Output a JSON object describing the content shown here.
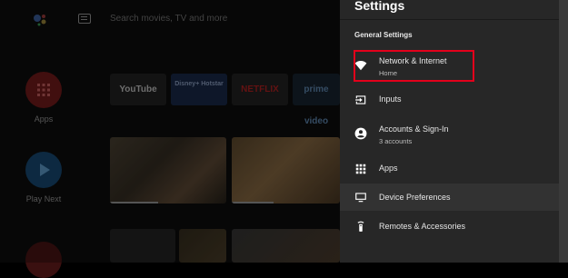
{
  "home": {
    "search": {
      "placeholder": "Search movies, TV and more"
    },
    "rail": [
      {
        "label": "Apps"
      },
      {
        "label": "Play Next"
      }
    ],
    "apps_row": [
      "YouTube",
      "Disney+ Hotstar",
      "NETFLIX",
      "prime video"
    ]
  },
  "settings_panel": {
    "title": "Settings",
    "section_header": "General Settings",
    "items": [
      {
        "label": "Network & Internet",
        "sub": "Home",
        "icon": "wifi-icon"
      },
      {
        "label": "Inputs",
        "sub": "",
        "icon": "input-icon"
      },
      {
        "label": "Accounts & Sign-In",
        "sub": "3 accounts",
        "icon": "account-icon"
      },
      {
        "label": "Apps",
        "sub": "",
        "icon": "apps-grid-icon"
      },
      {
        "label": "Device Preferences",
        "sub": "",
        "icon": "tv-icon"
      },
      {
        "label": "Remotes & Accessories",
        "sub": "",
        "icon": "remote-icon"
      }
    ],
    "colors": {
      "panel_bg": "#272727",
      "focus_border": "#e3001b",
      "highlight_row": "#323232"
    }
  }
}
